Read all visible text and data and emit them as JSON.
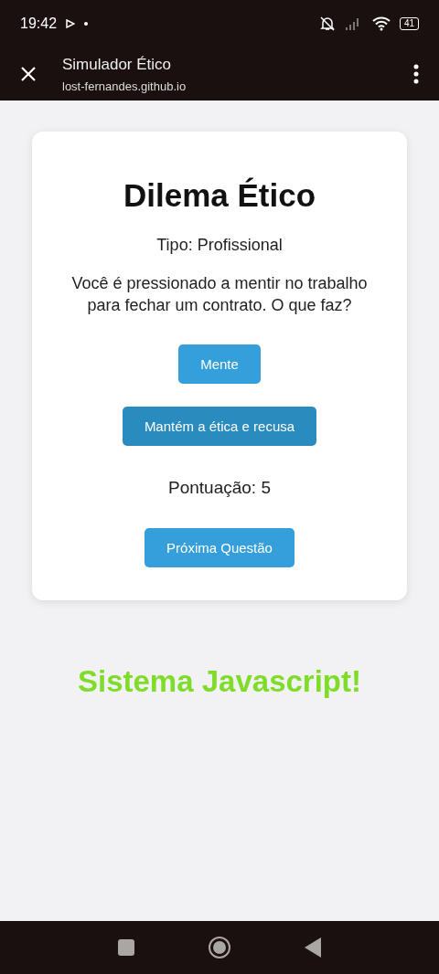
{
  "status_bar": {
    "time": "19:42",
    "battery": "41"
  },
  "browser_bar": {
    "title": "Simulador Ético",
    "url": "lost-fernandes.github.io"
  },
  "card": {
    "title": "Dilema Ético",
    "type": "Tipo: Profissional",
    "question": "Você é pressionado a mentir no trabalho para fechar um contrato. O que faz?",
    "options": [
      {
        "label": "Mente",
        "highlighted": false
      },
      {
        "label": "Mantém a ética e recusa",
        "highlighted": true
      }
    ],
    "score": "Pontuação: 5",
    "next_button": "Próxima Questão"
  },
  "footer_text": "Sistema Javascript!"
}
